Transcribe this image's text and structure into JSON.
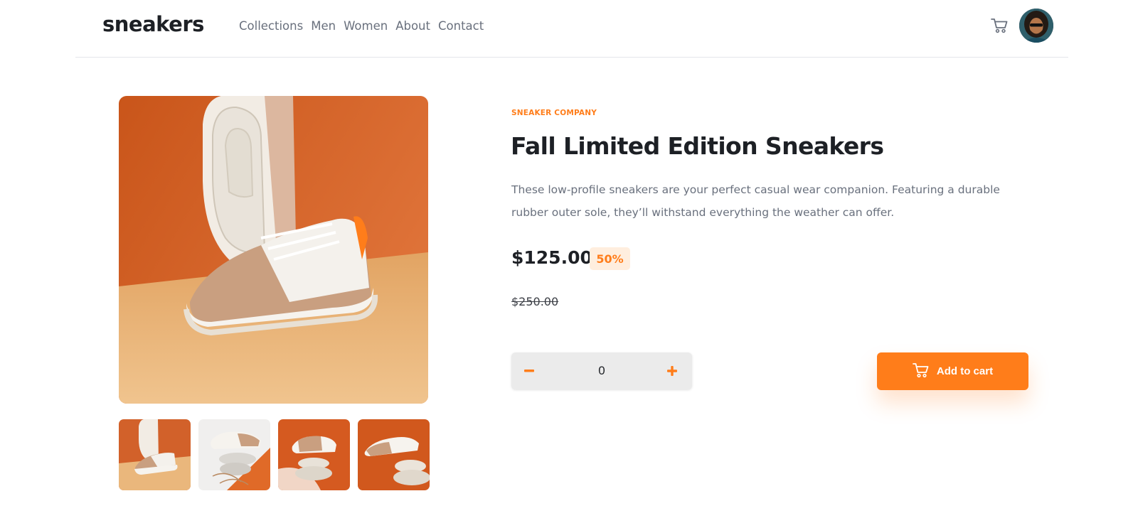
{
  "header": {
    "logo": "sneakers",
    "nav": [
      "Collections",
      "Men",
      "Women",
      "About",
      "Contact"
    ],
    "cart_icon": "cart-icon",
    "avatar_icon": "user-avatar"
  },
  "product": {
    "company": "SNEAKER COMPANY",
    "title": "Fall Limited Edition Sneakers",
    "description": "These low-profile sneakers are your perfect casual wear companion. Featuring a durable rubber outer sole, they’ll withstand everything the weather can offer.",
    "price": "$125.00",
    "discount": "50%",
    "original_price": "$250.00"
  },
  "quantity": {
    "value": "0",
    "minus_icon": "minus-icon",
    "plus_icon": "plus-icon"
  },
  "actions": {
    "add_to_cart": "Add to cart"
  },
  "colors": {
    "accent": "#ff7d1a",
    "accent_pale": "#ffeede",
    "text_dark": "#1d2025",
    "text_gray": "#69707d",
    "image_bg_orange": "#d9652a",
    "image_bg_sand": "#eab77c"
  }
}
